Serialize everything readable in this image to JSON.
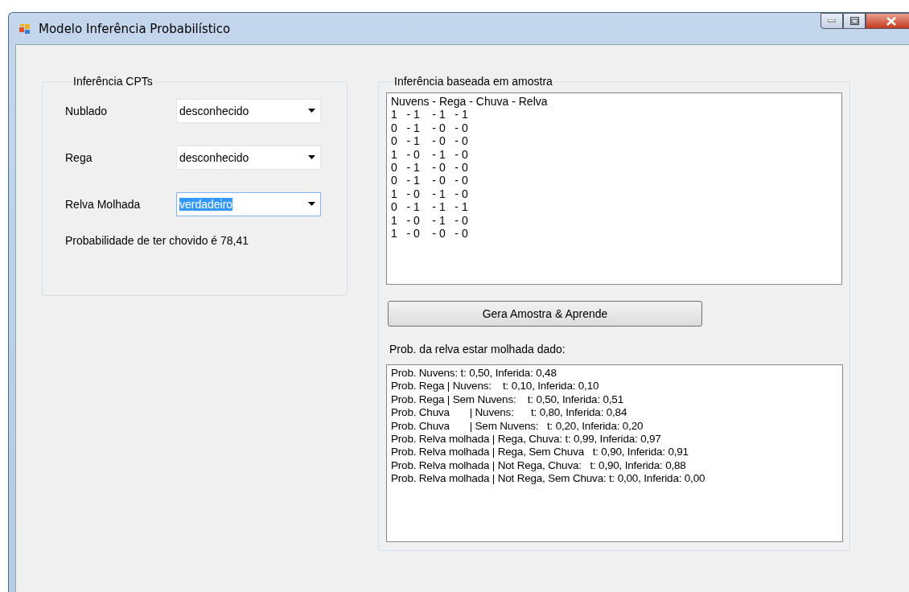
{
  "window": {
    "title": "Modelo Inferência Probabilístico"
  },
  "cpt_group": {
    "title": "Inferência CPTs",
    "fields": [
      {
        "label": "Nublado",
        "value": "desconhecido",
        "focused": false
      },
      {
        "label": "Rega",
        "value": "desconhecido",
        "focused": false
      },
      {
        "label": "Relva Molhada",
        "value": "verdadeiro",
        "focused": true
      }
    ],
    "result": "Probabilidade de ter chovido é 78,41"
  },
  "sample_group": {
    "title": "Inferência baseada em amostra",
    "sample_lines": [
      "Nuvens - Rega - Chuva - Relva",
      "1   - 1    - 1   - 1",
      "0   - 1    - 0   - 0",
      "0   - 1    - 0   - 0",
      "1   - 0    - 1   - 0",
      "0   - 1    - 0   - 0",
      "0   - 1    - 0   - 0",
      "1   - 0    - 1   - 0",
      "0   - 1    - 1   - 1",
      "1   - 0    - 1   - 0",
      "1   - 0    - 0   - 0"
    ],
    "button": "Gera Amostra & Aprende",
    "prob_label": "Prob. da relva estar molhada dado:",
    "prob_lines": [
      "Prob. Nuvens: t: 0,50, Inferida: 0,48",
      "Prob. Rega | Nuvens:    t: 0,10, Inferida: 0,10",
      "Prob. Rega | Sem Nuvens:    t: 0,50, Inferida: 0,51",
      "Prob. Chuva       | Nuvens:      t: 0,80, Inferida: 0,84",
      "Prob. Chuva       | Sem Nuvens:   t: 0,20, Inferida: 0,20",
      "Prob. Relva molhada | Rega, Chuva: t: 0,99, Inferida: 0,97",
      "Prob. Relva molhada | Rega, Sem Chuva   t: 0,90, Inferida: 0,91",
      "Prob. Relva molhada | Not Rega, Chuva:   t: 0,90, Inferida: 0,88",
      "Prob. Relva molhada | Not Rega, Sem Chuva: t: 0,00, Inferida: 0,00"
    ]
  }
}
